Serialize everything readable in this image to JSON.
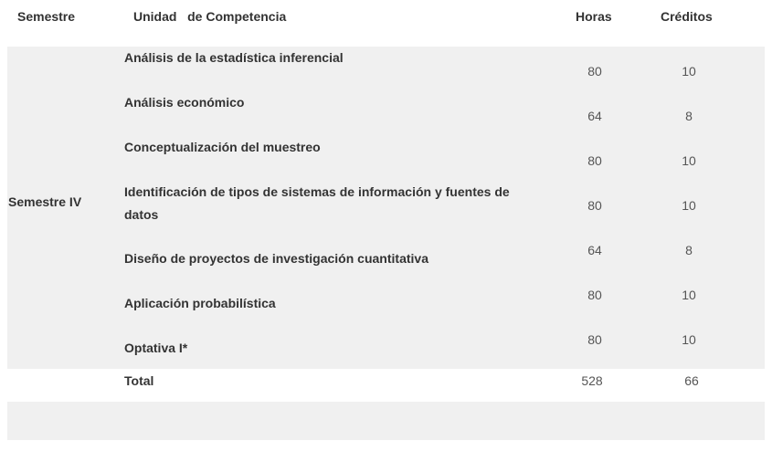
{
  "header": {
    "semestre": "Semestre",
    "unidad": "Unidad   de Competencia",
    "horas": "Horas",
    "creditos": "Créditos"
  },
  "semester": {
    "label": "Semestre IV",
    "rows": [
      {
        "unit": "Análisis de la estadística inferencial",
        "horas": "80",
        "creditos": "10"
      },
      {
        "unit": "Análisis económico",
        "horas": "64",
        "creditos": "8"
      },
      {
        "unit": "Conceptualización del muestreo",
        "horas": "80",
        "creditos": "10"
      },
      {
        "unit": "Identificación de tipos de sistemas de información y fuentes de datos",
        "horas": "80",
        "creditos": "10"
      },
      {
        "unit": "Diseño de proyectos de investigación cuantitativa",
        "horas": "64",
        "creditos": "8"
      },
      {
        "unit": "Aplicación probabilística",
        "horas": "80",
        "creditos": "10"
      },
      {
        "unit": "Optativa I*",
        "horas": "80",
        "creditos": "10"
      }
    ]
  },
  "total": {
    "label": "Total",
    "horas": "528",
    "creditos": "66"
  }
}
